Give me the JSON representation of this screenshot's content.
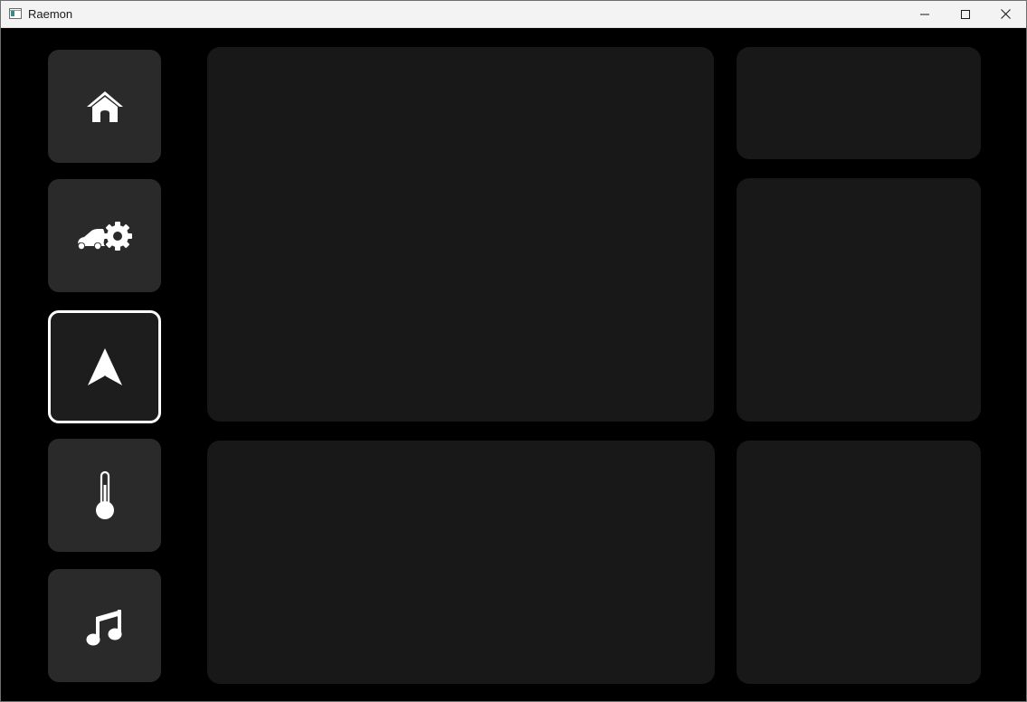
{
  "window": {
    "title": "Raemon",
    "controls": {
      "minimize_icon": "minimize-icon",
      "maximize_icon": "maximize-icon",
      "close_icon": "close-icon"
    }
  },
  "sidebar": {
    "items": [
      {
        "id": "home",
        "icon": "home-icon",
        "active": false
      },
      {
        "id": "vehicle-settings",
        "icon": "car-gear-icon",
        "active": false
      },
      {
        "id": "navigation",
        "icon": "navigation-arrow-icon",
        "active": true
      },
      {
        "id": "climate",
        "icon": "thermometer-icon",
        "active": false
      },
      {
        "id": "music",
        "icon": "music-note-icon",
        "active": false
      }
    ]
  },
  "colors": {
    "background": "#000000",
    "nav_button": "#2a2a2a",
    "nav_button_active_border": "#ffffff",
    "panel": "#181818",
    "icon": "#ffffff",
    "titlebar": "#f3f3f3"
  }
}
